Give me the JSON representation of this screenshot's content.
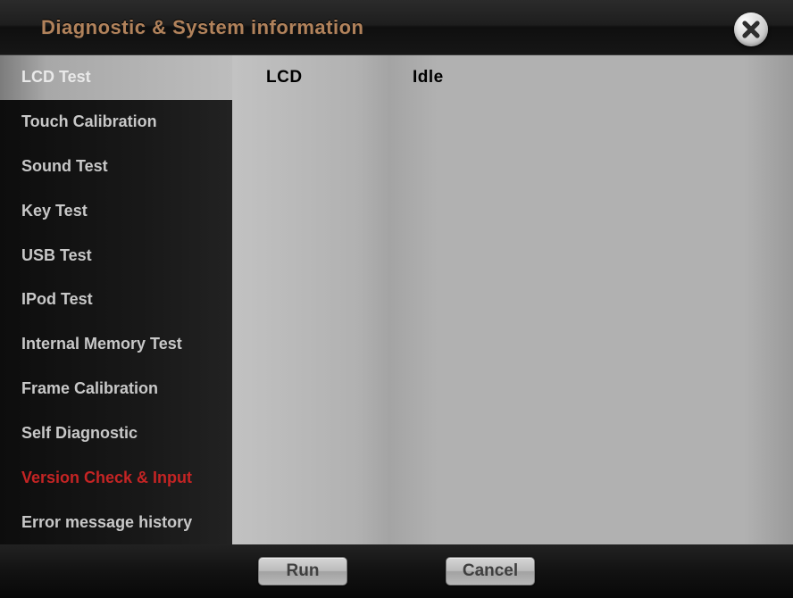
{
  "header": {
    "title": "Diagnostic & System information"
  },
  "sidebar": {
    "items": [
      {
        "label": "LCD Test"
      },
      {
        "label": "Touch Calibration"
      },
      {
        "label": "Sound Test"
      },
      {
        "label": "Key Test"
      },
      {
        "label": "USB Test"
      },
      {
        "label": "IPod Test"
      },
      {
        "label": "Internal Memory Test"
      },
      {
        "label": "Frame Calibration"
      },
      {
        "label": "Self Diagnostic"
      },
      {
        "label": "Version Check & Input"
      },
      {
        "label": "Error message history"
      }
    ],
    "selected_index": 0,
    "highlight_index": 9
  },
  "panel": {
    "left_label": "LCD",
    "right_label": "Idle"
  },
  "footer": {
    "run_label": "Run",
    "cancel_label": "Cancel"
  }
}
